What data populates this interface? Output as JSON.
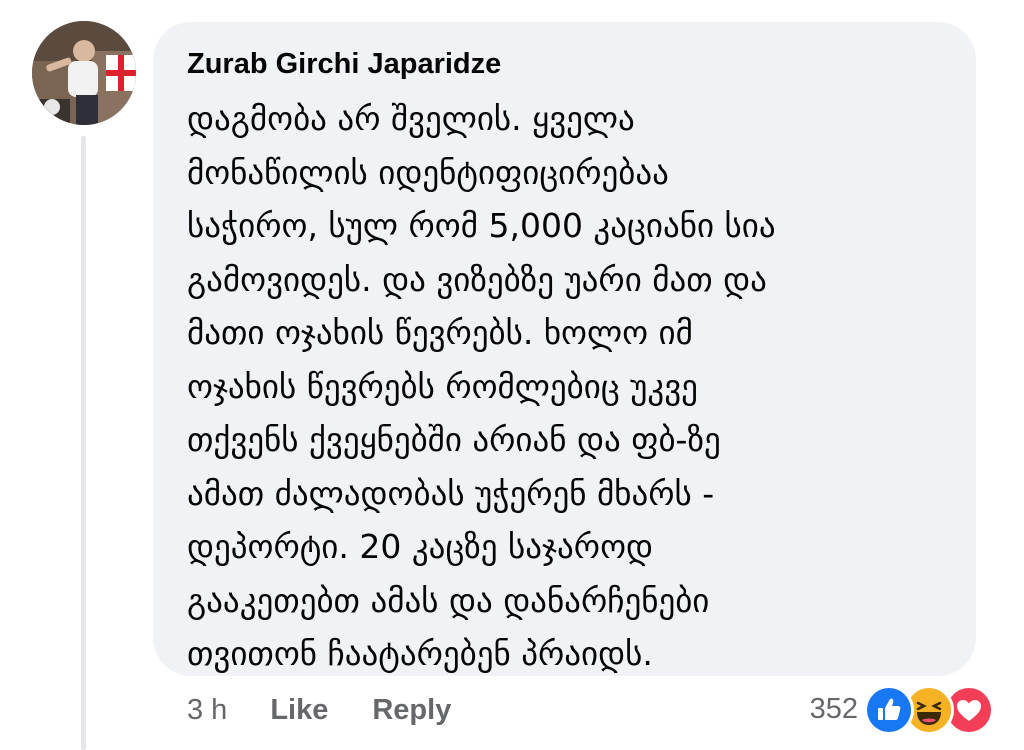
{
  "comment": {
    "author": "Zurab Girchi Japaridze",
    "lines": [
      "დაგმობა არ შველის. ყველა",
      "მონაწილის იდენტიფიცირებაა",
      "საჭირო, სულ რომ 5,000 კაციანი სია",
      "გამოვიდეს. და ვიზებზე უარი მათ და",
      "მათი ოჯახის წევრებს. ხოლო იმ",
      "ოჯახის წევრებს რომლებიც უკვე",
      "თქვენს ქვეყნებში არიან და ფბ-ზე",
      "ამათ ძალადობას უჭერენ მხარს -",
      "დეპორტი. 20 კაცზე საჯაროდ",
      "გააკეთებთ ამას და დანარჩენები",
      "თვითონ ჩაატარებენ პრაიდს."
    ]
  },
  "actions": {
    "time": "3 h",
    "like_label": "Like",
    "reply_label": "Reply"
  },
  "reactions": {
    "count": "352",
    "icons": [
      "like-icon",
      "haha-icon",
      "love-icon"
    ],
    "colors": {
      "like": "#1877f2",
      "haha": "#f7b125",
      "love": "#f33e58"
    }
  },
  "theme": {
    "bubble": "#f0f2f5",
    "text": "#050505",
    "muted": "#65676b",
    "thread_line": "#e4e6eb"
  }
}
